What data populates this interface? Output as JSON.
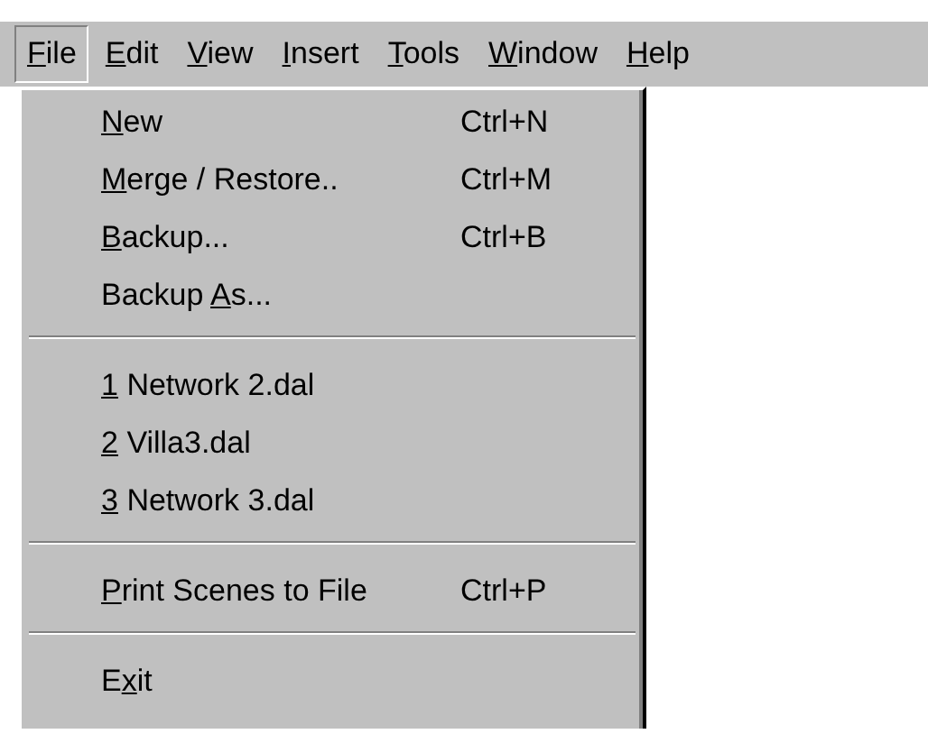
{
  "menu_bar": [
    {
      "key": "F",
      "after": "ile",
      "selected": true
    },
    {
      "key": "E",
      "after": "dit",
      "selected": false
    },
    {
      "key": "V",
      "after": "iew",
      "selected": false
    },
    {
      "key": "I",
      "after": "nsert",
      "selected": false
    },
    {
      "key": "T",
      "after": "ools",
      "selected": false
    },
    {
      "key": "W",
      "after": "indow",
      "selected": false
    },
    {
      "key": "H",
      "after": "elp",
      "selected": false
    }
  ],
  "file_menu": [
    {
      "kind": "item",
      "key": "N",
      "after": "ew",
      "shortcut": "Ctrl+N"
    },
    {
      "kind": "item",
      "key": "M",
      "after": "erge / Restore..",
      "shortcut": "Ctrl+M"
    },
    {
      "kind": "item",
      "key": "B",
      "after": "ackup...",
      "shortcut": "Ctrl+B"
    },
    {
      "kind": "item",
      "before": "Backup ",
      "key": "A",
      "after": "s..."
    },
    {
      "kind": "separator"
    },
    {
      "kind": "item",
      "key": "1",
      "after": " Network 2.dal"
    },
    {
      "kind": "item",
      "key": "2",
      "after": " Villa3.dal"
    },
    {
      "kind": "item",
      "key": "3",
      "after": " Network 3.dal"
    },
    {
      "kind": "separator"
    },
    {
      "kind": "item",
      "key": "P",
      "after": "rint Scenes to File",
      "shortcut": "Ctrl+P"
    },
    {
      "kind": "separator"
    },
    {
      "kind": "item",
      "before": "E",
      "key": "x",
      "after": "it"
    }
  ]
}
